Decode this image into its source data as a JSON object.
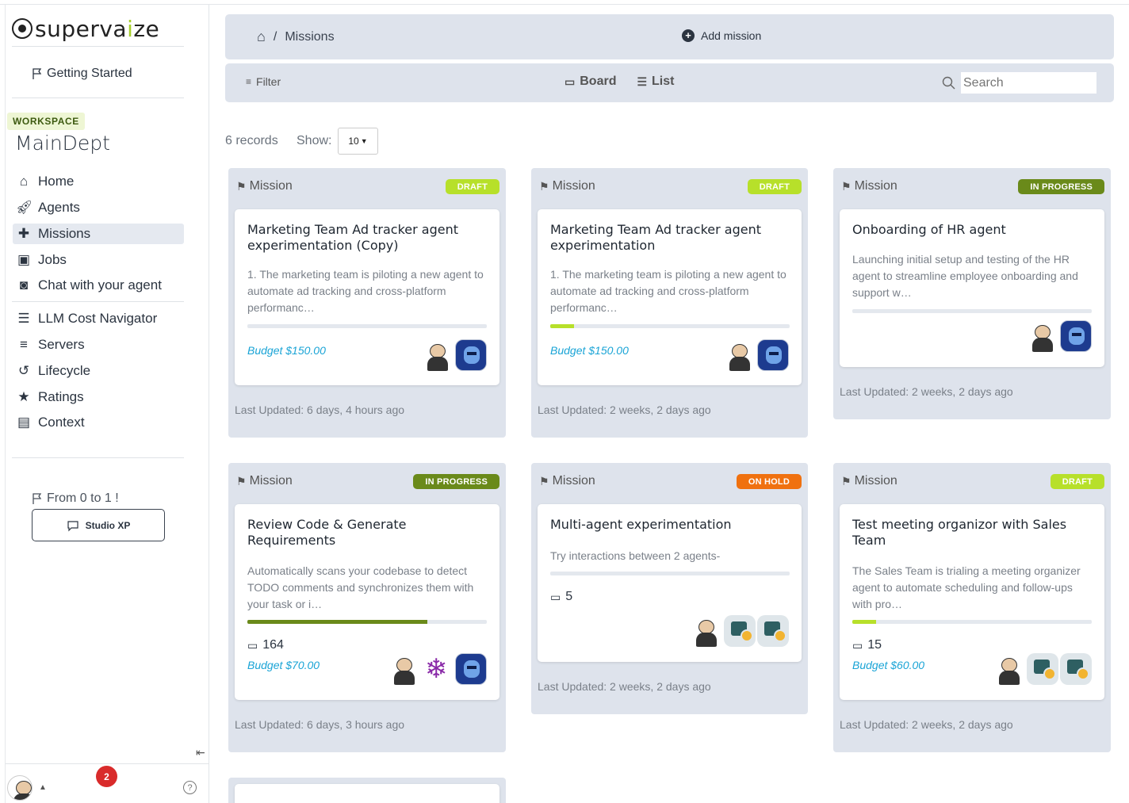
{
  "brand": {
    "logo_text_a": "superva",
    "logo_text_b": "i",
    "logo_text_c": "ze"
  },
  "sidebar": {
    "getting_started": "Getting Started",
    "workspace_badge": "WORKSPACE",
    "workspace_name": "MainDept",
    "items": [
      {
        "label": "Home",
        "icon": "home-icon"
      },
      {
        "label": "Agents",
        "icon": "rocket-icon"
      },
      {
        "label": "Missions",
        "icon": "puzzle-icon"
      },
      {
        "label": "Jobs",
        "icon": "briefcase-icon"
      },
      {
        "label": "Chat with your agent",
        "icon": "robot-icon"
      }
    ],
    "items2": [
      {
        "label": "LLM Cost Navigator",
        "icon": "chart-icon"
      },
      {
        "label": "Servers",
        "icon": "server-icon"
      },
      {
        "label": "Lifecycle",
        "icon": "history-icon"
      },
      {
        "label": "Ratings",
        "icon": "star-icon"
      },
      {
        "label": "Context",
        "icon": "archive-icon"
      }
    ],
    "from": "From 0 to 1 !",
    "studio": "Studio XP",
    "notifications": "2",
    "help": "?"
  },
  "header": {
    "crumb": "Missions",
    "add_mission": "Add mission"
  },
  "toolbar": {
    "filter": "Filter",
    "board": "Board",
    "list": "List",
    "search_placeholder": "Search"
  },
  "records": {
    "count": "6 records",
    "show": "Show:",
    "page_size": "10"
  },
  "column_label": "Mission",
  "missions": [
    {
      "status": "DRAFT",
      "title": "Marketing Team Ad tracker agent experimentation (Copy)",
      "desc": "1. The marketing team is piloting a new agent to automate ad tracking and cross-platform performanc…",
      "progress": 0,
      "budget": "Budget $150.00",
      "updated": "Last Updated: 6 days, 4 hours ago"
    },
    {
      "status": "DRAFT",
      "title": "Marketing Team Ad tracker agent experimentation",
      "desc": "1. The marketing team is piloting a new agent to automate ad tracking and cross-platform performanc…",
      "progress": 0.1,
      "budget": "Budget $150.00",
      "updated": "Last Updated: 2 weeks, 2 days ago"
    },
    {
      "status": "IN PROGRESS",
      "title": "Onboarding of HR agent",
      "desc": "Launching initial setup and testing of the HR agent to streamline employee onboarding and support w…",
      "progress": 0,
      "updated": "Last Updated: 2 weeks, 2 days ago"
    },
    {
      "status": "IN PROGRESS",
      "title": "Review Code & Generate Requirements",
      "desc": "Automatically scans your codebase to detect TODO comments and synchronizes them with your task or i…",
      "progress": 0.75,
      "jobs": "164",
      "budget": "Budget $70.00",
      "updated": "Last Updated: 6 days, 3 hours ago"
    },
    {
      "status": "ON HOLD",
      "title": "Multi-agent experimentation",
      "desc": "Try interactions between 2 agents-",
      "progress": 0,
      "jobs": "5",
      "updated": "Last Updated: 2 weeks, 2 days ago"
    },
    {
      "status": "DRAFT",
      "title": "Test meeting organizor with Sales Team",
      "desc": "The Sales Team is trialing a meeting organizer agent to automate scheduling and follow-ups with pro…",
      "progress": 0.1,
      "jobs": "15",
      "budget": "Budget $60.00",
      "updated": "Last Updated: 2 weeks, 2 days ago"
    }
  ],
  "colors": {
    "draft": "#b7e02a",
    "in_progress": "#6a8a1a",
    "on_hold": "#f0710f",
    "budget": "#1aa4d6"
  }
}
